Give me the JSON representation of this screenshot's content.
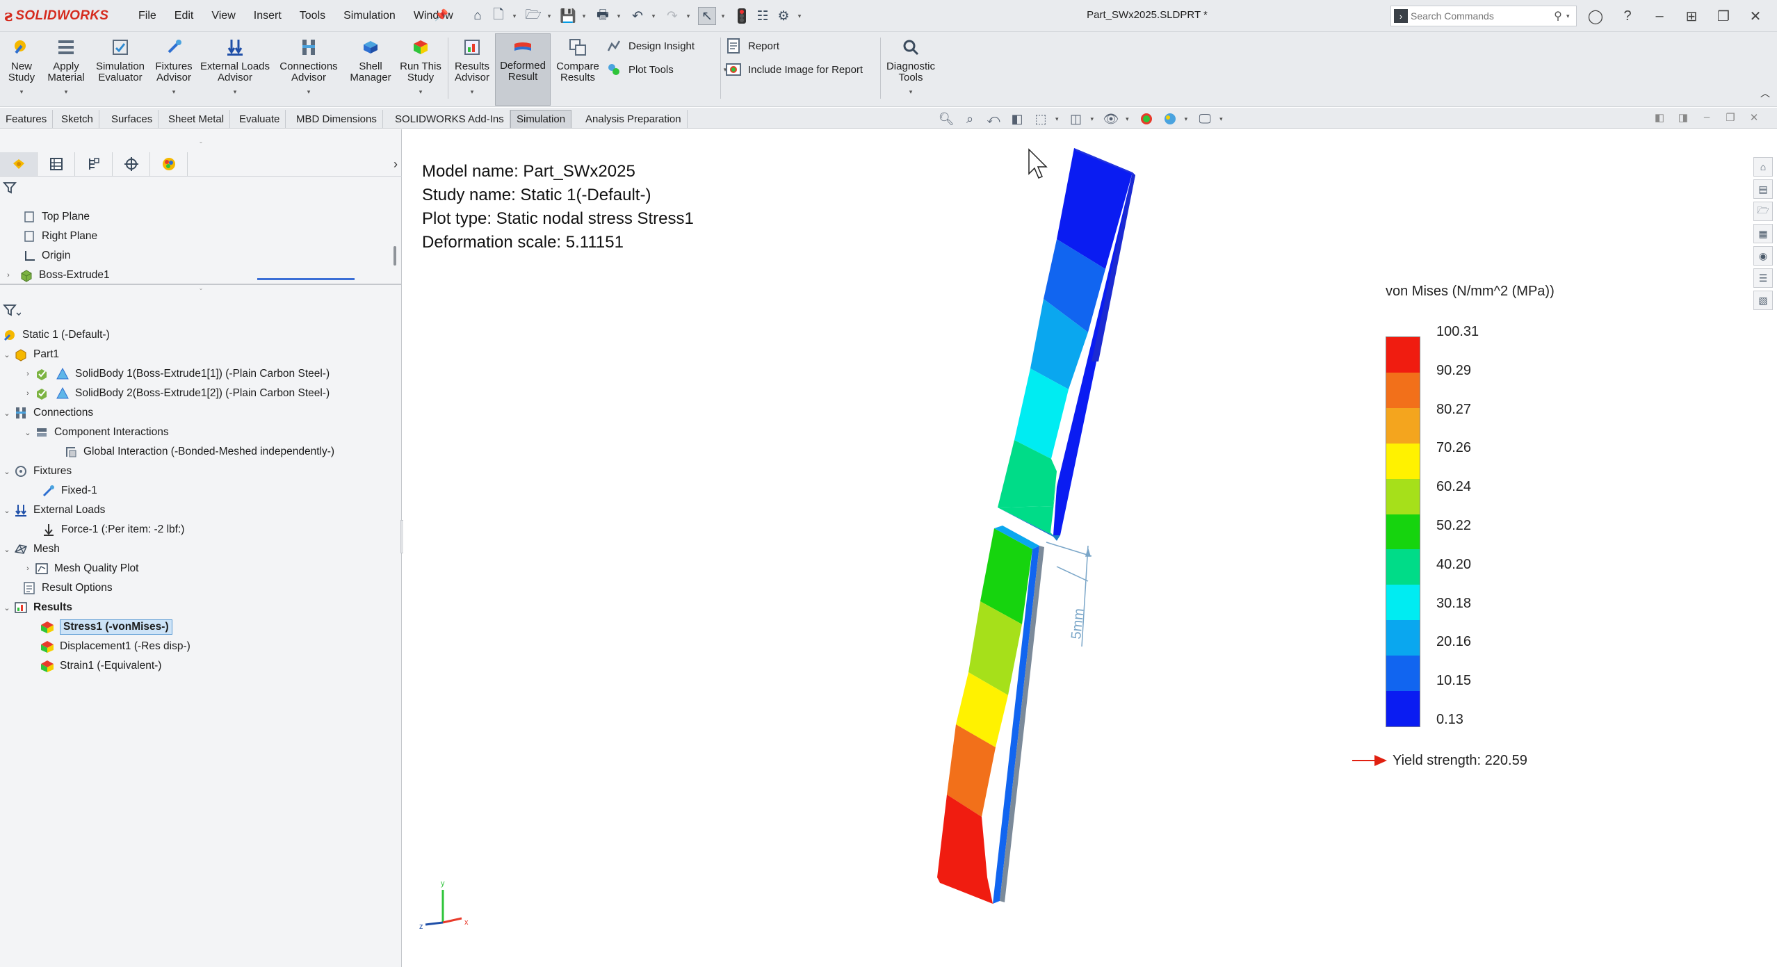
{
  "app": {
    "brand": "SOLIDWORKS",
    "doc_title": "Part_SWx2025.SLDPRT *",
    "menu": [
      "File",
      "Edit",
      "View",
      "Insert",
      "Tools",
      "Simulation",
      "Window"
    ]
  },
  "search": {
    "placeholder": "Search Commands"
  },
  "ribbon": {
    "buttons": [
      {
        "line1": "New",
        "line2": "Study",
        "icon": "new-study-icon"
      },
      {
        "line1": "Apply",
        "line2": "Material",
        "icon": "apply-material-icon"
      },
      {
        "line1": "Simulation",
        "line2": "Evaluator",
        "icon": "simulation-evaluator-icon"
      },
      {
        "line1": "Fixtures",
        "line2": "Advisor",
        "icon": "fixtures-advisor-icon"
      },
      {
        "line1": "External Loads",
        "line2": "Advisor",
        "icon": "external-loads-icon"
      },
      {
        "line1": "Connections",
        "line2": "Advisor",
        "icon": "connections-icon"
      },
      {
        "line1": "Shell",
        "line2": "Manager",
        "icon": "shell-manager-icon"
      },
      {
        "line1": "Run This",
        "line2": "Study",
        "icon": "run-study-icon"
      },
      {
        "line1": "Results",
        "line2": "Advisor",
        "icon": "results-advisor-icon"
      },
      {
        "line1": "Deformed",
        "line2": "Result",
        "icon": "deformed-result-icon"
      },
      {
        "line1": "Compare",
        "line2": "Results",
        "icon": "compare-results-icon"
      }
    ],
    "design_insight": "Design Insight",
    "plot_tools": "Plot Tools",
    "report": "Report",
    "include_image": "Include Image for Report",
    "diagnostic_line1": "Diagnostic",
    "diagnostic_line2": "Tools"
  },
  "tabs": [
    "Features",
    "Sketch",
    "Surfaces",
    "Sheet Metal",
    "Evaluate",
    "MBD Dimensions",
    "SOLIDWORKS Add-Ins",
    "Simulation",
    "Analysis Preparation"
  ],
  "feature_tree": {
    "items": [
      "Top Plane",
      "Right Plane",
      "Origin",
      "Boss-Extrude1"
    ]
  },
  "study_tree": {
    "study": "Static 1 (-Default-)",
    "part": "Part1",
    "body1": "SolidBody 1(Boss-Extrude1[1]) (-Plain Carbon Steel-)",
    "body2": "SolidBody 2(Boss-Extrude1[2]) (-Plain Carbon Steel-)",
    "connections": "Connections",
    "component_interactions": "Component Interactions",
    "global_interaction": "Global Interaction (-Bonded-Meshed independently-)",
    "fixtures": "Fixtures",
    "fixed": "Fixed-1",
    "external_loads": "External Loads",
    "force": "Force-1 (:Per item: -2 lbf:)",
    "mesh": "Mesh",
    "mesh_quality": "Mesh Quality Plot",
    "result_options": "Result Options",
    "results": "Results",
    "stress": "Stress1 (-vonMises-)",
    "displacement": "Displacement1 (-Res disp-)",
    "strain": "Strain1 (-Equivalent-)"
  },
  "plot_info": {
    "model": "Model name: Part_SWx2025",
    "study": "Study name: Static 1(-Default-)",
    "plot_type": "Plot type: Static nodal stress Stress1",
    "deformation": "Deformation scale: 5.11151"
  },
  "legend": {
    "title": "von Mises (N/mm^2 (MPa))",
    "labels": [
      "100.31",
      "90.29",
      "80.27",
      "70.26",
      "60.24",
      "50.22",
      "40.20",
      "30.18",
      "20.16",
      "10.15",
      "0.13"
    ],
    "colors": [
      "#f01c10",
      "#f2701a",
      "#f4a51e",
      "#fff200",
      "#a6e01a",
      "#16d40e",
      "#00dc88",
      "#00ecf2",
      "#0aa7ef",
      "#1165f0",
      "#0a1cf2"
    ],
    "yield": "Yield strength: 220.59"
  },
  "dimension": {
    "label": "5mm"
  },
  "triad": {
    "x": "x",
    "y": "y",
    "z": "z"
  }
}
